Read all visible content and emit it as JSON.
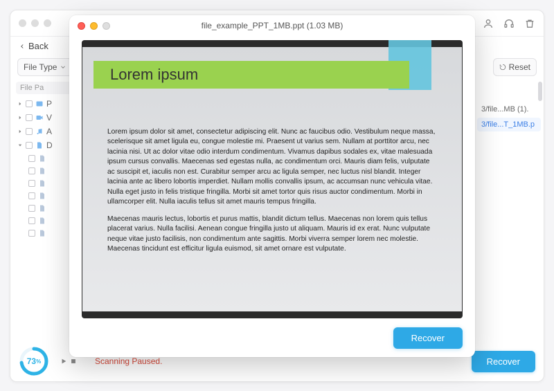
{
  "header": {
    "back_label": "Back",
    "icons": {
      "user": "user-icon",
      "support": "headset-icon",
      "trash": "trash-icon"
    }
  },
  "filters": {
    "file_type_label": "File Type",
    "reset_label": "Reset"
  },
  "sidebar": {
    "header": "File Pa",
    "items": [
      {
        "label": "P",
        "icon": "image-icon"
      },
      {
        "label": "V",
        "icon": "video-icon"
      },
      {
        "label": "A",
        "icon": "audio-icon"
      },
      {
        "label": "D",
        "icon": "document-icon",
        "expanded": true,
        "children": [
          "",
          "",
          "",
          "",
          "",
          "",
          ""
        ]
      }
    ]
  },
  "right_list": {
    "items": [
      {
        "text": "3/file...MB (1)."
      },
      {
        "text": "3/file...T_1MB.p",
        "selected": true
      }
    ]
  },
  "footer": {
    "progress_percent": 73,
    "progress_unit": "%",
    "status_text": "Scanning Paused.",
    "recover_label": "Recover",
    "colors": {
      "accent": "#2ea9e6",
      "error": "#d8493a"
    }
  },
  "modal": {
    "filename": "file_example_PPT_1MB.ppt",
    "size": "(1.03 MB)",
    "title_display": "file_example_PPT_1MB.ppt (1.03 MB)",
    "slide": {
      "heading": "Lorem ipsum",
      "paragraph1": "Lorem ipsum dolor sit amet, consectetur adipiscing elit. Nunc ac faucibus odio. Vestibulum neque massa, scelerisque sit amet ligula eu, congue molestie mi. Praesent ut varius sem. Nullam at porttitor arcu, nec lacinia nisi. Ut ac dolor vitae odio interdum condimentum. Vivamus dapibus sodales ex, vitae malesuada ipsum cursus convallis. Maecenas sed egestas nulla, ac condimentum orci. Mauris diam felis, vulputate ac suscipit et, iaculis non est. Curabitur semper arcu ac ligula semper, nec luctus nisl blandit. Integer lacinia ante ac libero lobortis imperdiet. Nullam mollis convallis ipsum, ac accumsan nunc vehicula vitae. Nulla eget justo in felis tristique fringilla. Morbi sit amet tortor quis risus auctor condimentum. Morbi in ullamcorper elit. Nulla iaculis tellus sit amet mauris tempus fringilla.",
      "paragraph2": "Maecenas mauris lectus, lobortis et purus mattis, blandit dictum tellus. Maecenas non lorem quis tellus placerat varius. Nulla facilisi. Aenean congue fringilla justo ut aliquam. Mauris id ex erat. Nunc vulputate neque vitae justo facilisis, non condimentum ante sagittis. Morbi viverra semper lorem nec molestie. Maecenas tincidunt est efficitur ligula euismod, sit amet ornare est vulputate."
    },
    "recover_label": "Recover"
  }
}
